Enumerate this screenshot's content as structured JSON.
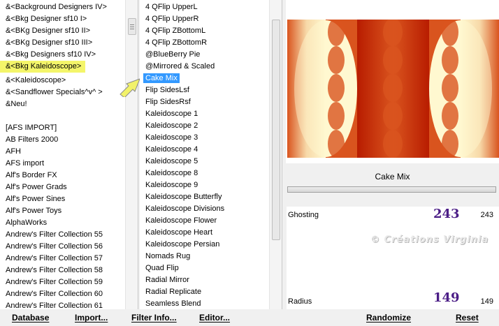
{
  "category_list": {
    "items": [
      {
        "label": "&<Background Designers IV>"
      },
      {
        "label": "&<Bkg Designer sf10 I>"
      },
      {
        "label": "&<BKg Designer sf10 II>"
      },
      {
        "label": "&<BKg Designer sf10 III>"
      },
      {
        "label": "&<Bkg Designers sf10 IV>"
      },
      {
        "label": "&<Bkg Kaleidoscope>",
        "state": "highlight"
      },
      {
        "label": "&<Kaleidoscope>"
      },
      {
        "label": "&<Sandflower Specials^v^ >"
      },
      {
        "label": "&Neu!"
      },
      {
        "label": ""
      },
      {
        "label": "[AFS IMPORT]"
      },
      {
        "label": "AB Filters 2000"
      },
      {
        "label": "AFH"
      },
      {
        "label": "AFS import"
      },
      {
        "label": "Alf's Border FX"
      },
      {
        "label": "Alf's Power Grads"
      },
      {
        "label": "Alf's Power Sines"
      },
      {
        "label": "Alf's Power Toys"
      },
      {
        "label": "AlphaWorks"
      },
      {
        "label": "Andrew's Filter Collection 55"
      },
      {
        "label": "Andrew's Filter Collection 56"
      },
      {
        "label": "Andrew's Filter Collection 57"
      },
      {
        "label": "Andrew's Filter Collection 58"
      },
      {
        "label": "Andrew's Filter Collection 59"
      },
      {
        "label": "Andrew's Filter Collection 60"
      },
      {
        "label": "Andrew's Filter Collection 61"
      }
    ]
  },
  "filter_list": {
    "items": [
      {
        "label": "4 QFlip UpperL"
      },
      {
        "label": "4 QFlip UpperR"
      },
      {
        "label": "4 QFlip ZBottomL"
      },
      {
        "label": "4 QFlip ZBottomR"
      },
      {
        "label": "@BlueBerry Pie"
      },
      {
        "label": "@Mirrored & Scaled"
      },
      {
        "label": "Cake Mix",
        "state": "selected"
      },
      {
        "label": "Flip SidesLsf"
      },
      {
        "label": "Flip SidesRsf"
      },
      {
        "label": "Kaleidoscope 1"
      },
      {
        "label": "Kaleidoscope 2"
      },
      {
        "label": "Kaleidoscope 3"
      },
      {
        "label": "Kaleidoscope 4"
      },
      {
        "label": "Kaleidoscope 5"
      },
      {
        "label": "Kaleidoscope 8"
      },
      {
        "label": "Kaleidoscope 9"
      },
      {
        "label": "Kaleidoscope Butterfly"
      },
      {
        "label": "Kaleidoscope Divisions"
      },
      {
        "label": "Kaleidoscope Flower"
      },
      {
        "label": "Kaleidoscope Heart"
      },
      {
        "label": "Kaleidoscope Persian"
      },
      {
        "label": "Nomads Rug"
      },
      {
        "label": "Quad Flip"
      },
      {
        "label": "Radial Mirror"
      },
      {
        "label": "Radial Replicate"
      },
      {
        "label": "Seamless Blend"
      }
    ]
  },
  "preview": {
    "colors": {
      "orange": "#d9541e",
      "dark_red": "#b81c00",
      "cream": "#fff8d0",
      "peach": "#f7d9a8"
    }
  },
  "filter_name": "Cake Mix",
  "params": {
    "ghosting": {
      "label": "Ghosting",
      "big_value": "243",
      "value": "243"
    },
    "radius": {
      "label": "Radius",
      "big_value": "149",
      "value": "149"
    }
  },
  "watermark": "© Créations Virginia",
  "toolbar": {
    "database": "Database",
    "import": "Import...",
    "filter_info": "Filter Info...",
    "editor": "Editor...",
    "randomize": "Randomize",
    "reset": "Reset"
  }
}
